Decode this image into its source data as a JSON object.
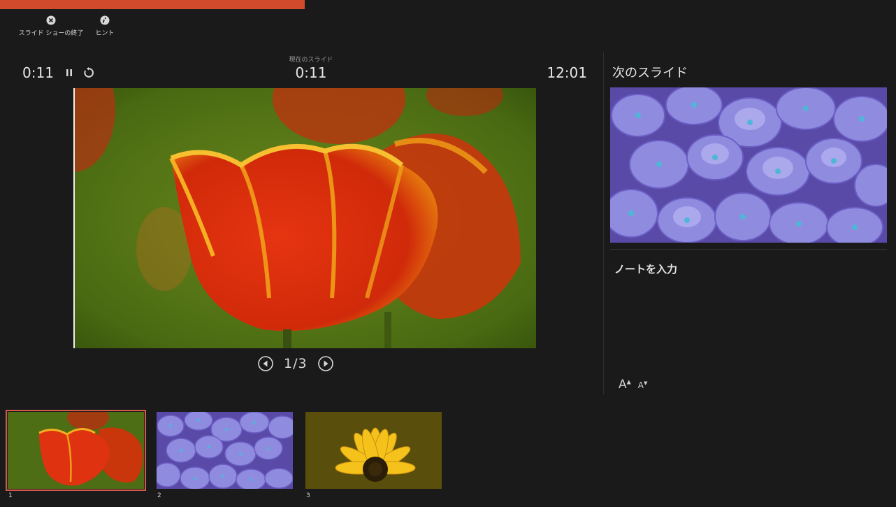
{
  "toolbar": {
    "end_show_label": "スライド ショーの終了",
    "hint_label": "ヒント"
  },
  "timers": {
    "elapsed": "0:11",
    "current_slide_label": "現在のスライド",
    "current_slide_time": "0:11",
    "clock": "12:01"
  },
  "progress": {
    "fraction": 0.34,
    "color": "#d04a2b"
  },
  "navigation": {
    "counter": "1/3"
  },
  "next_panel": {
    "title": "次のスライド",
    "notes_placeholder": "ノートを入力",
    "font_increase": "A",
    "font_decrease": "A"
  },
  "thumbnails": [
    {
      "number": "1",
      "image": "red-tulip",
      "selected": true
    },
    {
      "number": "2",
      "image": "blue-hydrangea",
      "selected": false
    },
    {
      "number": "3",
      "image": "yellow-sunflower",
      "selected": false
    }
  ],
  "colors": {
    "background": "#1a1a1a",
    "accent": "#d04a2b",
    "selection": "#d15a4a"
  }
}
